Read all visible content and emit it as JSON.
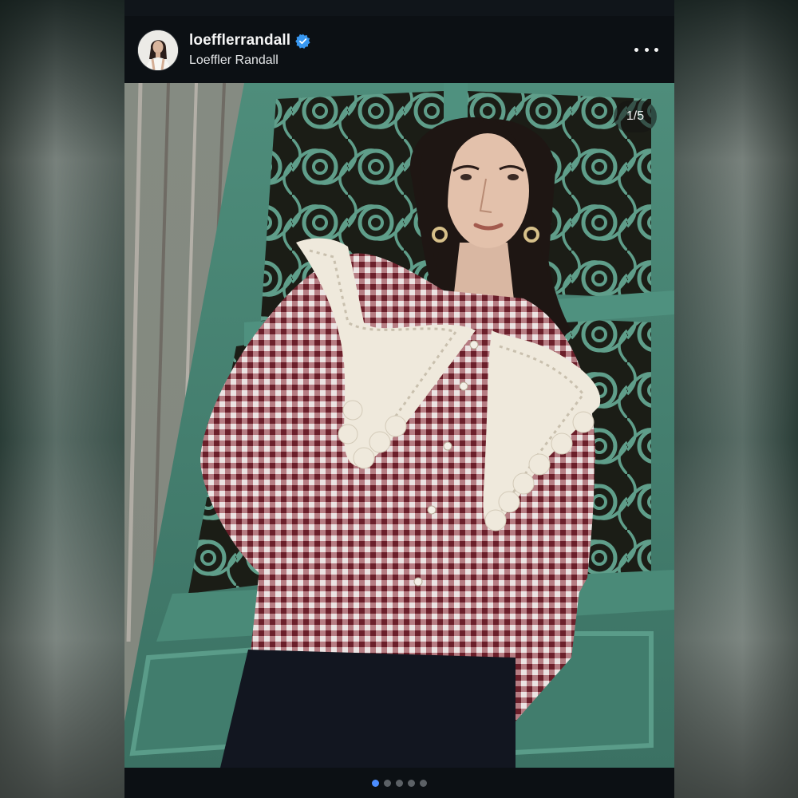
{
  "post": {
    "username": "loefflerrandall",
    "fullname": "Loeffler Randall",
    "verified": true,
    "more_icon": "more-horizontal-icon"
  },
  "carousel": {
    "counter": "1/5",
    "current": 1,
    "total": 5
  },
  "colors": {
    "accent": "#4c8dff",
    "verified": "#3897f0",
    "background": "#0c1014"
  }
}
